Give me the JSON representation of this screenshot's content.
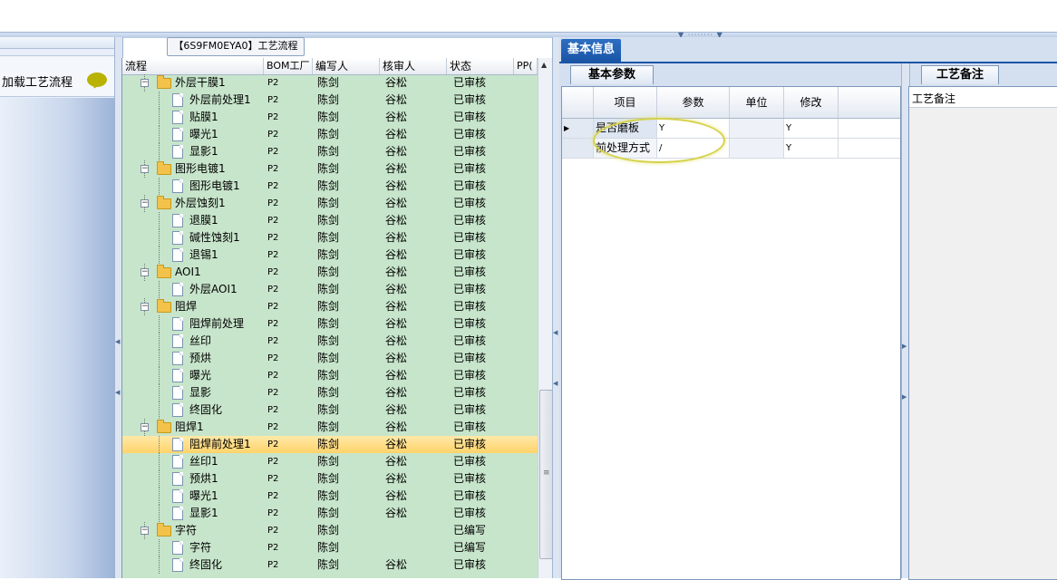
{
  "left_panel": {
    "load_flow_label": "加载工艺流程",
    "comment_icon": "speech-bubble-icon"
  },
  "tree": {
    "caption": "【6S9FM0EYA0】工艺流程",
    "columns": [
      "流程",
      "BOM工厂",
      "编写人",
      "核审人",
      "状态",
      "PP("
    ],
    "rows": [
      {
        "level": 1,
        "name": "外层干膜1",
        "bom": "P2",
        "writer": "陈剑",
        "reviewer": "谷松",
        "status": "已审核",
        "folder": true
      },
      {
        "level": 2,
        "name": "外层前处理1",
        "bom": "P2",
        "writer": "陈剑",
        "reviewer": "谷松",
        "status": "已审核",
        "folder": false
      },
      {
        "level": 2,
        "name": "贴膜1",
        "bom": "P2",
        "writer": "陈剑",
        "reviewer": "谷松",
        "status": "已审核",
        "folder": false
      },
      {
        "level": 2,
        "name": "曝光1",
        "bom": "P2",
        "writer": "陈剑",
        "reviewer": "谷松",
        "status": "已审核",
        "folder": false
      },
      {
        "level": 2,
        "name": "显影1",
        "bom": "P2",
        "writer": "陈剑",
        "reviewer": "谷松",
        "status": "已审核",
        "folder": false
      },
      {
        "level": 1,
        "name": "图形电镀1",
        "bom": "P2",
        "writer": "陈剑",
        "reviewer": "谷松",
        "status": "已审核",
        "folder": true
      },
      {
        "level": 2,
        "name": "图形电镀1",
        "bom": "P2",
        "writer": "陈剑",
        "reviewer": "谷松",
        "status": "已审核",
        "folder": false
      },
      {
        "level": 1,
        "name": "外层蚀刻1",
        "bom": "P2",
        "writer": "陈剑",
        "reviewer": "谷松",
        "status": "已审核",
        "folder": true
      },
      {
        "level": 2,
        "name": "退膜1",
        "bom": "P2",
        "writer": "陈剑",
        "reviewer": "谷松",
        "status": "已审核",
        "folder": false
      },
      {
        "level": 2,
        "name": "碱性蚀刻1",
        "bom": "P2",
        "writer": "陈剑",
        "reviewer": "谷松",
        "status": "已审核",
        "folder": false
      },
      {
        "level": 2,
        "name": "退锡1",
        "bom": "P2",
        "writer": "陈剑",
        "reviewer": "谷松",
        "status": "已审核",
        "folder": false
      },
      {
        "level": 1,
        "name": "AOI1",
        "bom": "P2",
        "writer": "陈剑",
        "reviewer": "谷松",
        "status": "已审核",
        "folder": true
      },
      {
        "level": 2,
        "name": "外层AOI1",
        "bom": "P2",
        "writer": "陈剑",
        "reviewer": "谷松",
        "status": "已审核",
        "folder": false
      },
      {
        "level": 1,
        "name": "阻焊",
        "bom": "P2",
        "writer": "陈剑",
        "reviewer": "谷松",
        "status": "已审核",
        "folder": true
      },
      {
        "level": 2,
        "name": "阻焊前处理",
        "bom": "P2",
        "writer": "陈剑",
        "reviewer": "谷松",
        "status": "已审核",
        "folder": false
      },
      {
        "level": 2,
        "name": "丝印",
        "bom": "P2",
        "writer": "陈剑",
        "reviewer": "谷松",
        "status": "已审核",
        "folder": false
      },
      {
        "level": 2,
        "name": "预烘",
        "bom": "P2",
        "writer": "陈剑",
        "reviewer": "谷松",
        "status": "已审核",
        "folder": false
      },
      {
        "level": 2,
        "name": "曝光",
        "bom": "P2",
        "writer": "陈剑",
        "reviewer": "谷松",
        "status": "已审核",
        "folder": false
      },
      {
        "level": 2,
        "name": "显影",
        "bom": "P2",
        "writer": "陈剑",
        "reviewer": "谷松",
        "status": "已审核",
        "folder": false
      },
      {
        "level": 2,
        "name": "终固化",
        "bom": "P2",
        "writer": "陈剑",
        "reviewer": "谷松",
        "status": "已审核",
        "folder": false
      },
      {
        "level": 1,
        "name": "阻焊1",
        "bom": "P2",
        "writer": "陈剑",
        "reviewer": "谷松",
        "status": "已审核",
        "folder": true
      },
      {
        "level": 2,
        "name": "阻焊前处理1",
        "bom": "P2",
        "writer": "陈剑",
        "reviewer": "谷松",
        "status": "已审核",
        "folder": false,
        "selected": true
      },
      {
        "level": 2,
        "name": "丝印1",
        "bom": "P2",
        "writer": "陈剑",
        "reviewer": "谷松",
        "status": "已审核",
        "folder": false
      },
      {
        "level": 2,
        "name": "预烘1",
        "bom": "P2",
        "writer": "陈剑",
        "reviewer": "谷松",
        "status": "已审核",
        "folder": false
      },
      {
        "level": 2,
        "name": "曝光1",
        "bom": "P2",
        "writer": "陈剑",
        "reviewer": "谷松",
        "status": "已审核",
        "folder": false
      },
      {
        "level": 2,
        "name": "显影1",
        "bom": "P2",
        "writer": "陈剑",
        "reviewer": "谷松",
        "status": "已审核",
        "folder": false
      },
      {
        "level": 1,
        "name": "字符",
        "bom": "P2",
        "writer": "陈剑",
        "reviewer": "",
        "status": "已编写",
        "folder": true
      },
      {
        "level": 2,
        "name": "字符",
        "bom": "P2",
        "writer": "陈剑",
        "reviewer": "",
        "status": "已编写",
        "folder": false
      },
      {
        "level": 2,
        "name": "终固化",
        "bom": "P2",
        "writer": "陈剑",
        "reviewer": "谷松",
        "status": "已审核",
        "folder": false
      }
    ]
  },
  "right_panel": {
    "main_tab": "基本信息",
    "params_tab": "基本参数",
    "params_columns": [
      "项目",
      "参数",
      "单位",
      "修改"
    ],
    "params_rows": [
      {
        "item": "是否磨板",
        "param": "Y",
        "unit": "",
        "modify": "Y",
        "current": true
      },
      {
        "item": "前处理方式",
        "param": "/",
        "unit": "",
        "modify": "Y",
        "current": false
      }
    ],
    "notes_tab": "工艺备注",
    "notes_label": "工艺备注"
  },
  "colors": {
    "tree_bg": "#c7e5cb",
    "selected_row": "#ffd36a",
    "tab_active": "#1a55a6",
    "highlight_ellipse": "#d6d24a"
  }
}
